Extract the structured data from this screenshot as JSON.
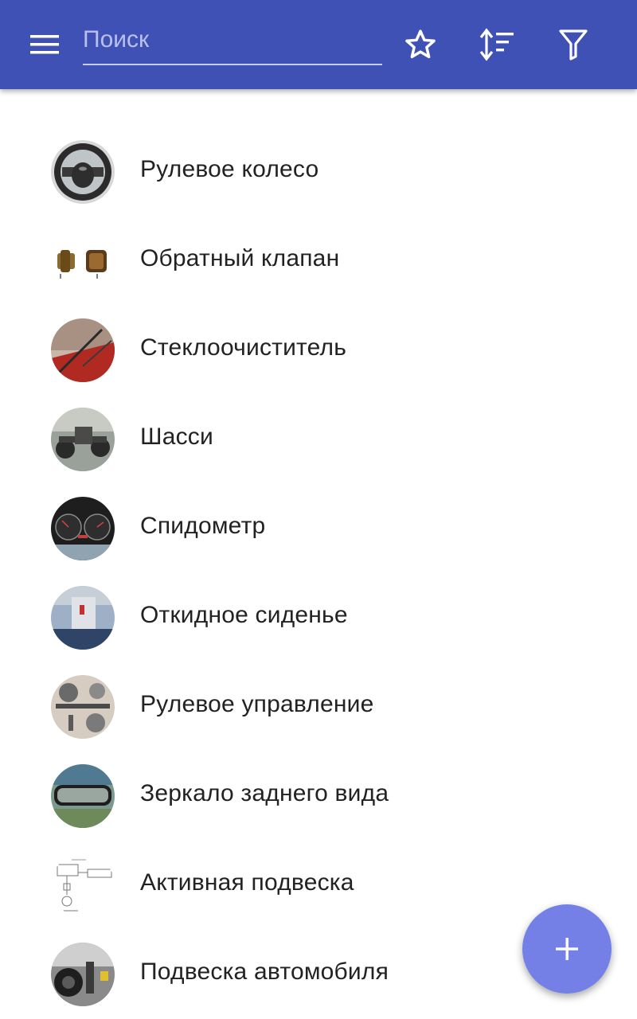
{
  "appbar": {
    "color": "#3f51b5",
    "menu_icon": "menu-icon",
    "search": {
      "placeholder": "Поиск",
      "value": ""
    },
    "actions": [
      {
        "icon": "star-outline-icon"
      },
      {
        "icon": "sort-icon"
      },
      {
        "icon": "filter-icon"
      }
    ]
  },
  "items": [
    {
      "label": "Рулевое колесо"
    },
    {
      "label": "Обратный клапан"
    },
    {
      "label": "Стеклоочиститель"
    },
    {
      "label": "Шасси"
    },
    {
      "label": "Спидометр"
    },
    {
      "label": "Откидное сиденье"
    },
    {
      "label": "Рулевое управление"
    },
    {
      "label": "Зеркало заднего вида"
    },
    {
      "label": "Активная подвеска"
    },
    {
      "label": "Подвеска автомобиля"
    }
  ],
  "fab": {
    "icon": "plus-icon",
    "color": "#7480e6"
  }
}
